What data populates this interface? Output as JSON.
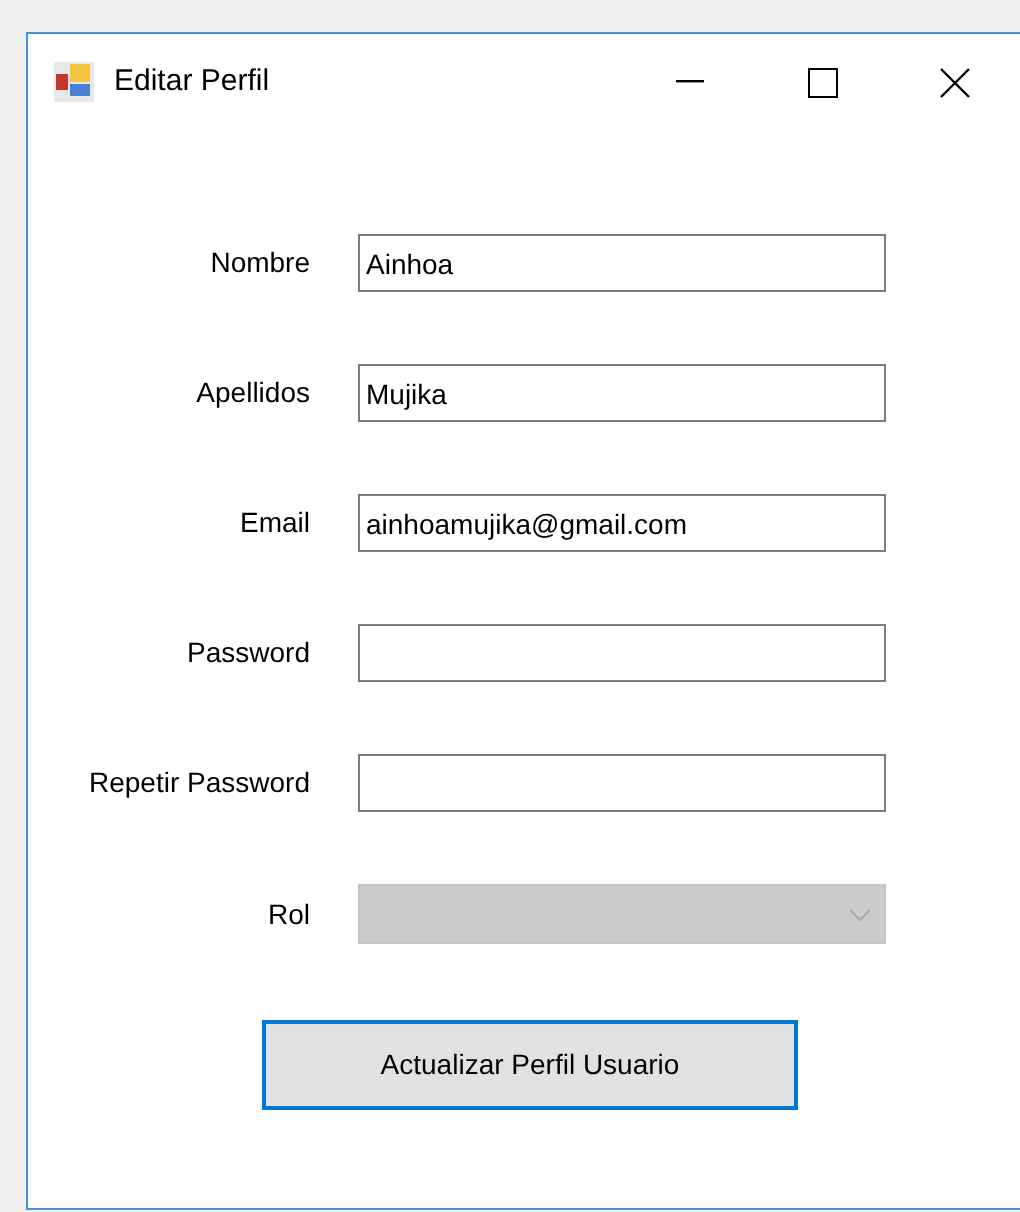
{
  "window": {
    "title": "Editar Perfil"
  },
  "fields": [
    {
      "label": "Nombre",
      "kind": "text",
      "value": "Ainhoa"
    },
    {
      "label": "Apellidos",
      "kind": "text",
      "value": "Mujika"
    },
    {
      "label": "Email",
      "kind": "text",
      "value": "ainhoamujika@gmail.com"
    },
    {
      "label": "Password",
      "kind": "text"
    },
    {
      "label": "Repetir Password",
      "kind": "text"
    },
    {
      "label": "Rol",
      "kind": "combo",
      "disabled": true
    }
  ],
  "button": {
    "label": "Actualizar Perfil Usuario",
    "focused": true
  }
}
